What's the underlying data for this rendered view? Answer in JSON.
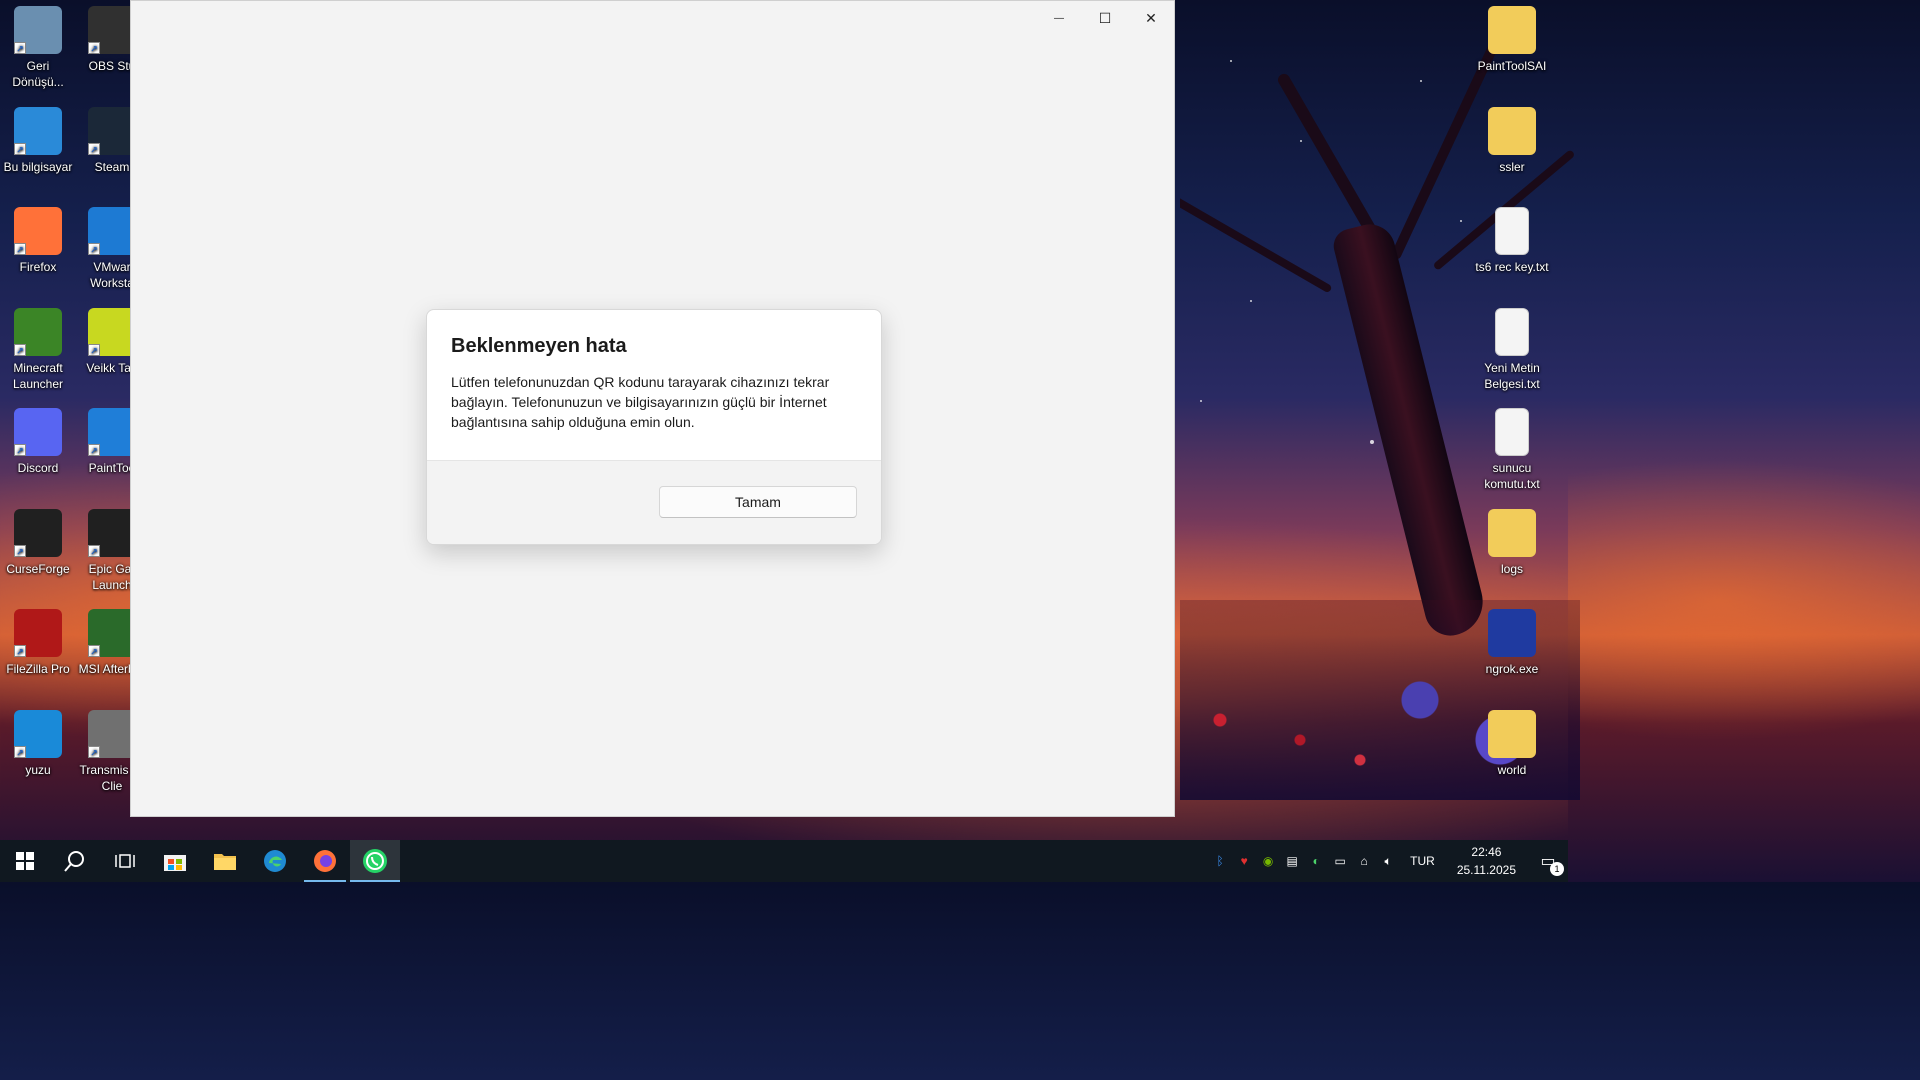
{
  "desktop": {
    "left_icons": [
      {
        "label": "Geri Dönüşü...",
        "icon": "recycle-bin-icon",
        "color": "#6a8fb0"
      },
      {
        "label": "OBS Stu",
        "icon": "obs-icon",
        "color": "#303030"
      },
      {
        "label": "Bu bilgisayar",
        "icon": "computer-icon",
        "color": "#2a8ad8"
      },
      {
        "label": "Steam",
        "icon": "steam-icon",
        "color": "#1b2838"
      },
      {
        "label": "Firefox",
        "icon": "firefox-icon",
        "color": "#ff7139"
      },
      {
        "label": "VMwar Worksta",
        "icon": "vmware-icon",
        "color": "#1d7ad3"
      },
      {
        "label": "Minecraft Launcher",
        "icon": "minecraft-icon",
        "color": "#3b8526"
      },
      {
        "label": "Veikk Tab",
        "icon": "veikk-icon",
        "color": "#c8d820"
      },
      {
        "label": "Discord",
        "icon": "discord-icon",
        "color": "#5865f2"
      },
      {
        "label": "PaintToo",
        "icon": "painttool-icon",
        "color": "#1f7ed8"
      },
      {
        "label": "CurseForge",
        "icon": "curseforge-icon",
        "color": "#202020"
      },
      {
        "label": "Epic Gar Launch",
        "icon": "epic-games-icon",
        "color": "#202020"
      },
      {
        "label": "FileZilla Pro",
        "icon": "filezilla-icon",
        "color": "#b01818"
      },
      {
        "label": "MSI Afterbur",
        "icon": "msi-afterburner-icon",
        "color": "#2a6a2a"
      },
      {
        "label": "yuzu",
        "icon": "yuzu-icon",
        "color": "#1a8ad8"
      },
      {
        "label": "Transmis Qt Clie",
        "icon": "transmission-icon",
        "color": "#707070"
      }
    ],
    "right_icons": [
      {
        "label": "PaintToolSAI",
        "icon": "folder-icon",
        "color": "#f2cc5a"
      },
      {
        "label": "ssler",
        "icon": "folder-icon",
        "color": "#f2cc5a"
      },
      {
        "label": "ts6 rec key.txt",
        "icon": "text-file-icon",
        "color": "#f4f4f4"
      },
      {
        "label": "Yeni Metin Belgesi.txt",
        "icon": "text-file-icon",
        "color": "#f4f4f4"
      },
      {
        "label": "sunucu komutu.txt",
        "icon": "text-file-icon",
        "color": "#f4f4f4"
      },
      {
        "label": "logs",
        "icon": "folder-icon",
        "color": "#f2cc5a"
      },
      {
        "label": "ngrok.exe",
        "icon": "ngrok-icon",
        "color": "#1f3aa0"
      },
      {
        "label": "world",
        "icon": "folder-icon",
        "color": "#f2cc5a"
      }
    ]
  },
  "window": {
    "controls": {
      "minimize": "—",
      "maximize": "☐",
      "close": "✕"
    }
  },
  "dialog": {
    "title": "Beklenmeyen hata",
    "message": "Lütfen telefonunuzdan QR kodunu tarayarak cihazınızı tekrar bağlayın. Telefonunuzun ve bilgisayarınızın güçlü bir İnternet bağlantısına sahip olduğuna emin olun.",
    "ok_label": "Tamam"
  },
  "taskbar": {
    "apps": [
      {
        "name": "start-button",
        "icon": "windows-icon"
      },
      {
        "name": "search-button",
        "icon": "search-icon"
      },
      {
        "name": "task-view-button",
        "icon": "task-view-icon"
      },
      {
        "name": "store-button",
        "icon": "store-icon"
      },
      {
        "name": "file-explorer-button",
        "icon": "folder-icon"
      },
      {
        "name": "edge-button",
        "icon": "edge-icon"
      },
      {
        "name": "firefox-button",
        "icon": "firefox-icon"
      },
      {
        "name": "whatsapp-button",
        "icon": "whatsapp-icon"
      }
    ],
    "tray": {
      "language": "TUR",
      "time": "22:46",
      "date": "25.11.2025",
      "notification_count": "1"
    }
  }
}
